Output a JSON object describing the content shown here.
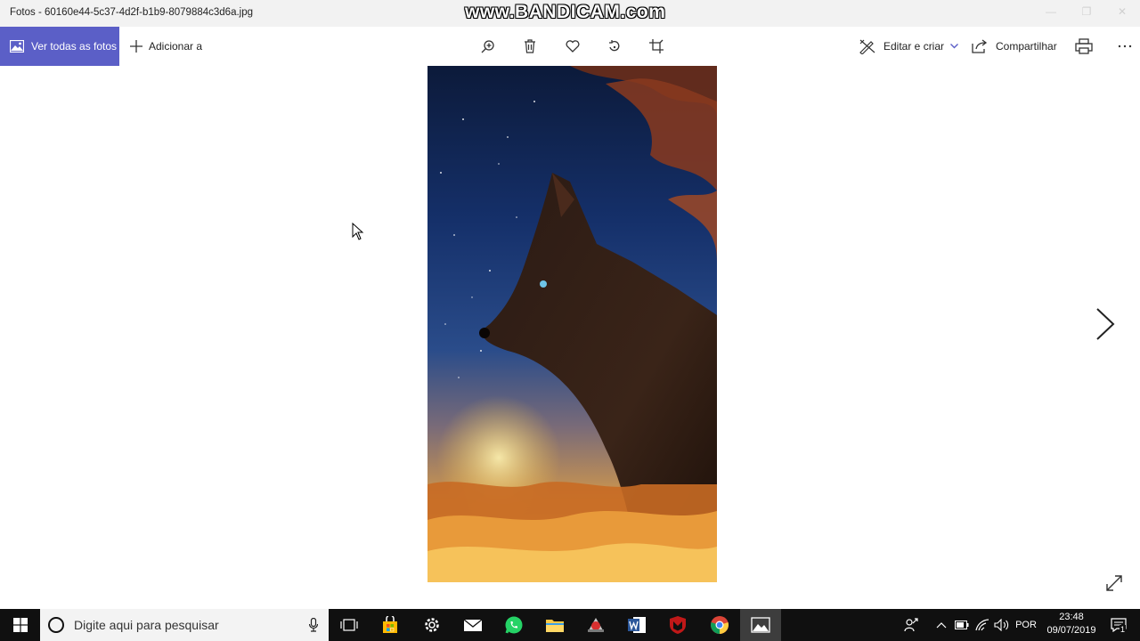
{
  "window": {
    "title": "Fotos - 60160e44-5c37-4d2f-b1b9-8079884c3d6a.jpg",
    "watermark": "www.BANDICAM.com"
  },
  "toolbar": {
    "view_all_label": "Ver todas as fotos",
    "add_to_label": "Adicionar a",
    "edit_create_label": "Editar e criar",
    "share_label": "Compartilhar",
    "accent_color": "#5b5fc7",
    "center_tools": [
      "zoom-in-icon",
      "delete-icon",
      "favorite-icon",
      "rotate-icon",
      "crop-icon"
    ]
  },
  "photo": {
    "subject": "wolf-moon-clouds-artwork"
  },
  "taskbar": {
    "search_placeholder": "Digite aqui para pesquisar",
    "apps": [
      "task-view",
      "store",
      "settings",
      "mail",
      "whatsapp",
      "file-explorer",
      "app",
      "word",
      "mcafee",
      "chrome",
      "photos"
    ],
    "language": "POR",
    "time": "23:48",
    "date": "09/07/2019",
    "notification_count": "1"
  }
}
